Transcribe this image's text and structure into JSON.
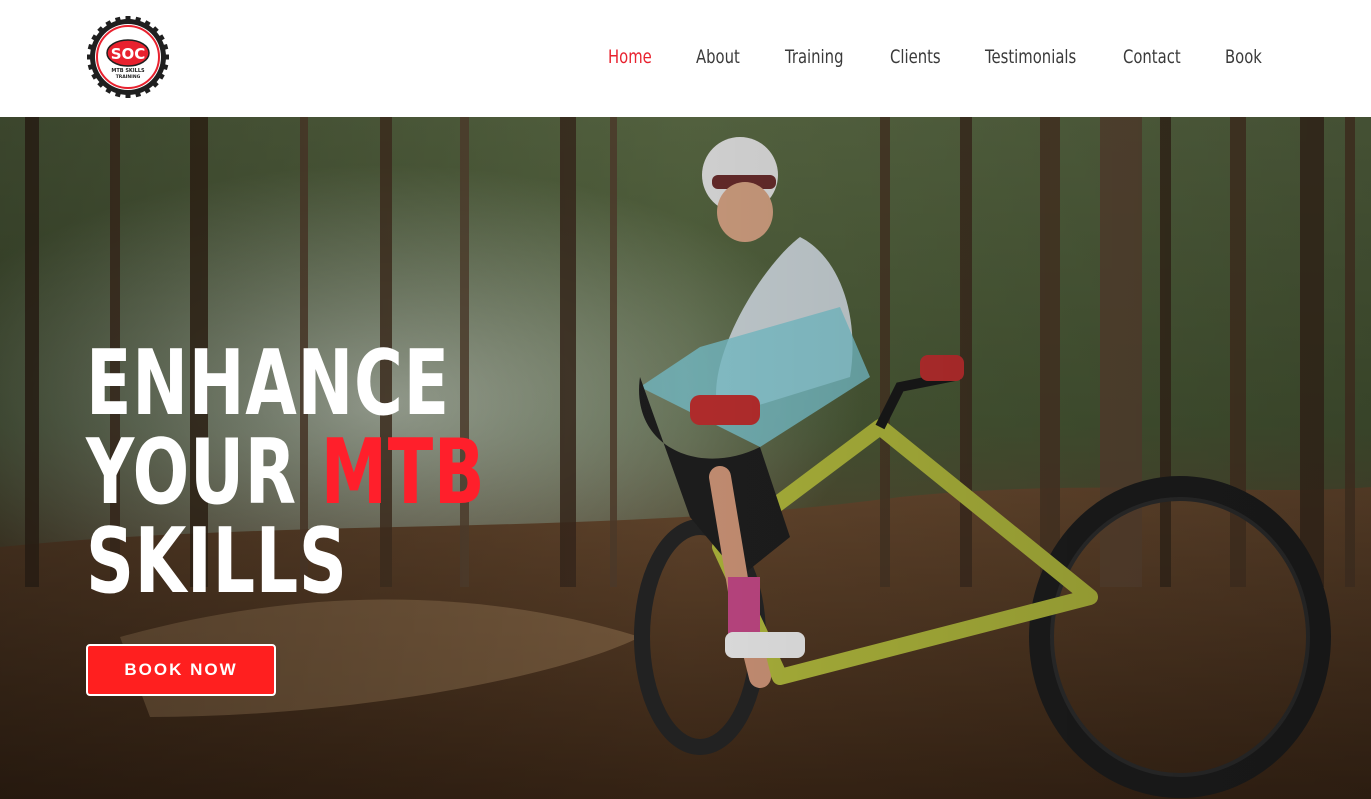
{
  "logo": {
    "text_main": "SOC",
    "text_sub1": "MTB SKILLS",
    "text_sub2": "TRAINING",
    "ring_color": "#1f1f1f",
    "accent_color": "#e8212e"
  },
  "nav": {
    "items": [
      {
        "label": "Home",
        "active": true
      },
      {
        "label": "About",
        "active": false
      },
      {
        "label": "Training",
        "active": false
      },
      {
        "label": "Clients",
        "active": false
      },
      {
        "label": "Testimonials",
        "active": false
      },
      {
        "label": "Contact",
        "active": false
      },
      {
        "label": "Book",
        "active": false
      }
    ],
    "active_color": "#e8212e",
    "text_color": "#3a3a3a"
  },
  "hero": {
    "title_line1": "ENHANCE",
    "title_line2_plain": "YOUR",
    "title_line2_accent": "MTB",
    "title_line3": "SKILLS",
    "accent_color": "#ff1f2b",
    "cta_label": "BOOK NOW",
    "cta_color": "#ff1f1f",
    "image_description_icon": "mountain-biker-photo"
  }
}
